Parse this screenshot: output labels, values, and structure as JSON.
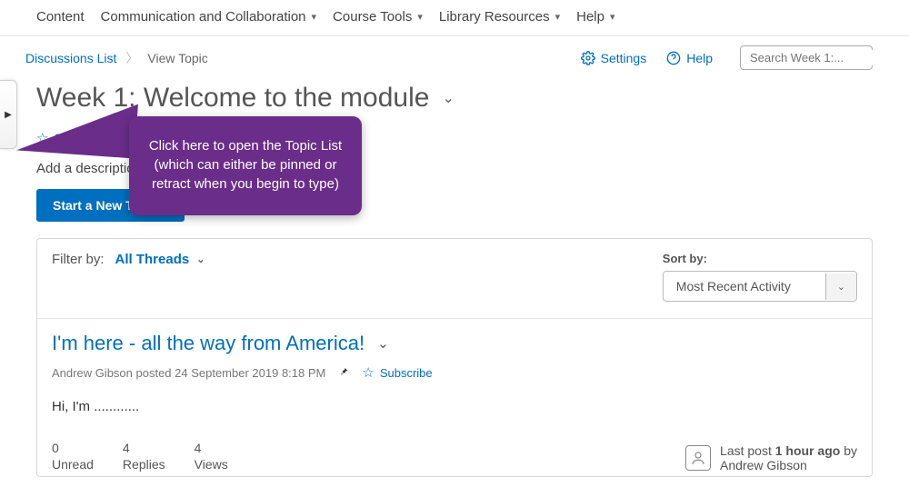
{
  "nav": {
    "items": [
      "Content",
      "Communication and Collaboration",
      "Course Tools",
      "Library Resources",
      "Help"
    ],
    "dropdown": [
      false,
      true,
      true,
      true,
      true
    ]
  },
  "crumbs": {
    "list_label": "Discussions List",
    "current": "View Topic"
  },
  "tools": {
    "settings": "Settings",
    "help": "Help"
  },
  "search": {
    "placeholder": "Search Week 1:..."
  },
  "topic": {
    "title": "Week 1: Welcome to the module",
    "subscribe": "Subscribe",
    "desc_prompt": "Add a description...",
    "start_button": "Start a New Thread"
  },
  "filter": {
    "label": "Filter by:",
    "value": "All Threads"
  },
  "sort": {
    "label": "Sort by:",
    "value": "Most Recent Activity"
  },
  "thread": {
    "title": "I'm here - all the way from America!",
    "meta": "Andrew Gibson posted 24 September 2019 8:18 PM",
    "subscribe": "Subscribe",
    "body": "Hi, I'm ............",
    "stats": {
      "unread_n": "0",
      "unread_l": "Unread",
      "replies_n": "4",
      "replies_l": "Replies",
      "views_n": "4",
      "views_l": "Views"
    },
    "last_post_prefix": "Last post ",
    "last_post_time": "1 hour ago",
    "last_post_suffix": " by",
    "last_post_author": "Andrew Gibson"
  },
  "callout": "Click here to open the Topic List (which can either be pinned or retract when you begin to type)"
}
